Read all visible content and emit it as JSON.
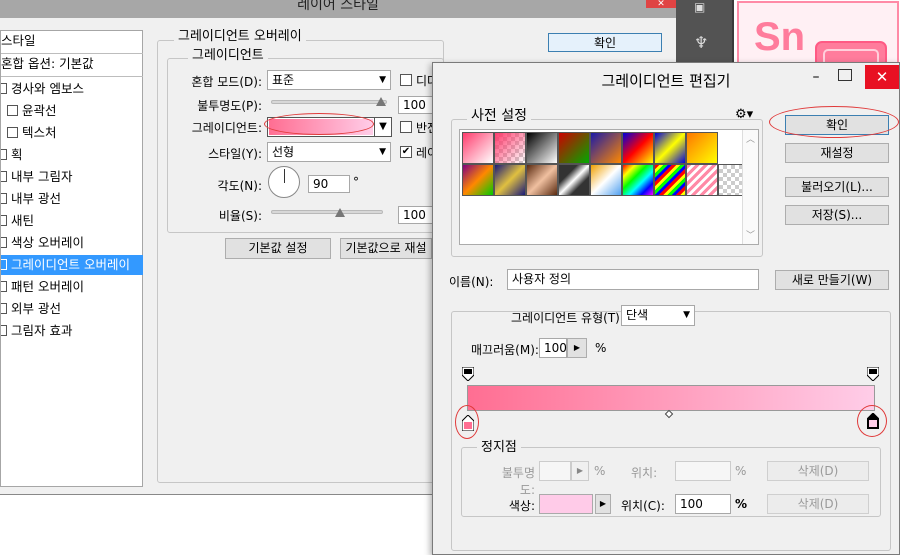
{
  "layer_style": {
    "title": "레이어 스타일",
    "styles_header": "스타일",
    "blend_options": "혼합 옵션: 기본값",
    "items": [
      {
        "label": "경사와 엠보스",
        "sub": false,
        "selected": false
      },
      {
        "label": "윤곽선",
        "sub": true,
        "selected": false
      },
      {
        "label": "텍스처",
        "sub": true,
        "selected": false
      },
      {
        "label": "획",
        "sub": false,
        "selected": false
      },
      {
        "label": "내부 그림자",
        "sub": false,
        "selected": false
      },
      {
        "label": "내부 광선",
        "sub": false,
        "selected": false
      },
      {
        "label": "새틴",
        "sub": false,
        "selected": false
      },
      {
        "label": "색상 오버레이",
        "sub": false,
        "selected": false
      },
      {
        "label": "그레이디언트 오버레이",
        "sub": false,
        "selected": true
      },
      {
        "label": "패턴 오버레이",
        "sub": false,
        "selected": false
      },
      {
        "label": "외부 광선",
        "sub": false,
        "selected": false
      },
      {
        "label": "그림자 효과",
        "sub": false,
        "selected": false
      }
    ],
    "group_title": "그레이디언트 오버레이",
    "subgroup_title": "그레이디언트",
    "blend_mode_label": "혼합 모드(D):",
    "blend_mode_value": "표준",
    "dither_label": "디더",
    "opacity_label": "불투명도(P):",
    "opacity_value": "100",
    "gradient_label": "그레이디언트:",
    "reverse_label": "반전",
    "style_label": "스타일(Y):",
    "style_value": "선형",
    "align_label": "레이",
    "angle_label": "각도(N):",
    "angle_value": "90",
    "angle_unit": "°",
    "scale_label": "비율(S):",
    "scale_value": "100",
    "make_default": "기본값 설정",
    "reset_default": "기본값으로 재설",
    "ok": "확인"
  },
  "gradient_editor": {
    "title": "그레이디언트 편집기",
    "presets_label": "사전 설정",
    "gear_icon": "gear-icon",
    "ok": "확인",
    "reset": "재설정",
    "load": "불러오기(L)...",
    "save": "저장(S)...",
    "name_label": "이름(N):",
    "name_value": "사용자 정의",
    "new_label": "새로 만들기(W)",
    "type_label": "그레이디언트 유형(T):",
    "type_value": "단색",
    "smooth_label": "매끄러움(M):",
    "smooth_value": "100",
    "smooth_unit": "%",
    "stops_label": "정지점",
    "stop_opacity_label": "불투명도:",
    "stop_opacity_unit": "%",
    "stop_location_label": "위치:",
    "stop_location_unit": "%",
    "delete_label": "삭제(D)",
    "stop_color_label": "색상:",
    "stop_color_location_label": "위치(C):",
    "stop_color_location_value": "100",
    "stop_color_location_unit": "%",
    "gradient_start_color": "#ff6e92",
    "gradient_end_color": "#ffcde8",
    "stop_color_value": "#ffcbe8"
  },
  "accent": {
    "selection": "#3399ff",
    "annotation": "#e03a3a"
  }
}
